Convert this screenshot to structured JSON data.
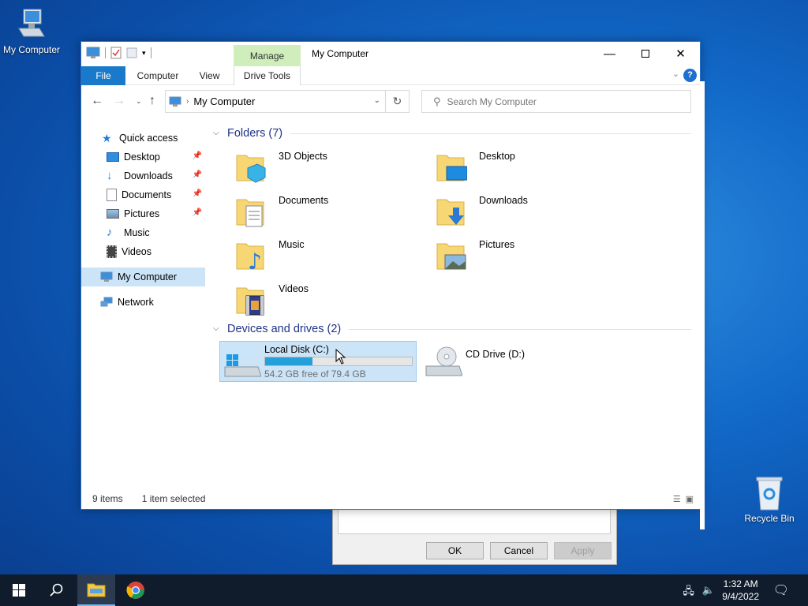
{
  "desktop": {
    "icons": [
      {
        "label": "My Computer",
        "icon": "computer-icon"
      },
      {
        "label": "Recycle Bin",
        "icon": "recycle-bin-icon"
      }
    ]
  },
  "bg_dialog": {
    "ok": "OK",
    "cancel": "Cancel",
    "apply": "Apply"
  },
  "window": {
    "title": "My Computer",
    "context_tab": "Manage",
    "ribbon_tabs": {
      "file": "File",
      "computer": "Computer",
      "view": "View",
      "drive_tools": "Drive Tools"
    },
    "address": "My Computer",
    "search_placeholder": "Search My Computer",
    "sidebar": [
      {
        "label": "Quick access",
        "icon": "star-icon",
        "pinned": false
      },
      {
        "label": "Desktop",
        "icon": "desktop-icon",
        "pinned": true
      },
      {
        "label": "Downloads",
        "icon": "download-icon",
        "pinned": true
      },
      {
        "label": "Documents",
        "icon": "documents-icon",
        "pinned": true
      },
      {
        "label": "Pictures",
        "icon": "pictures-icon",
        "pinned": true
      },
      {
        "label": "Music",
        "icon": "music-icon",
        "pinned": false
      },
      {
        "label": "Videos",
        "icon": "videos-icon",
        "pinned": false
      },
      {
        "label": "My Computer",
        "icon": "computer-icon",
        "selected": true
      },
      {
        "label": "Network",
        "icon": "network-icon"
      }
    ],
    "folders_header": "Folders (7)",
    "folders": [
      {
        "label": "3D Objects",
        "icon": "3d-objects-icon"
      },
      {
        "label": "Desktop",
        "icon": "desktop-folder-icon"
      },
      {
        "label": "Documents",
        "icon": "documents-folder-icon"
      },
      {
        "label": "Downloads",
        "icon": "downloads-folder-icon"
      },
      {
        "label": "Music",
        "icon": "music-folder-icon"
      },
      {
        "label": "Pictures",
        "icon": "pictures-folder-icon"
      },
      {
        "label": "Videos",
        "icon": "videos-folder-icon"
      }
    ],
    "drives_header": "Devices and drives (2)",
    "drives": [
      {
        "label": "Local Disk (C:)",
        "free_text": "54.2 GB free of 79.4 GB",
        "used_fraction": 0.32,
        "selected": true
      },
      {
        "label": "CD Drive (D:)"
      }
    ],
    "status": {
      "items": "9 items",
      "selection": "1 item selected"
    }
  },
  "taskbar": {
    "time": "1:32 AM",
    "date": "9/4/2022"
  },
  "colors": {
    "accent": "#1979ca",
    "selection": "#cce4f7",
    "bar_fill": "#26a0da",
    "taskbar": "#101c2c"
  }
}
